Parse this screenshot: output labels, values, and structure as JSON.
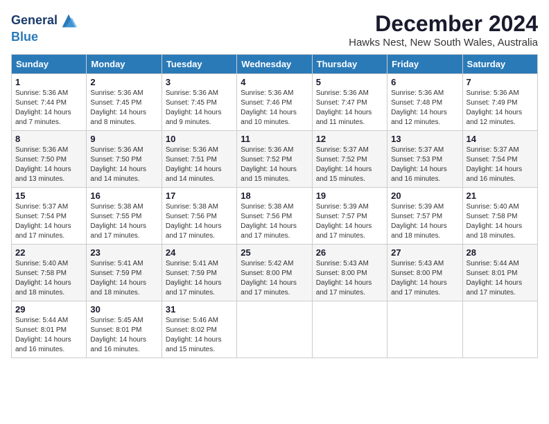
{
  "header": {
    "logo_line1": "General",
    "logo_line2": "Blue",
    "month_title": "December 2024",
    "location": "Hawks Nest, New South Wales, Australia"
  },
  "days_of_week": [
    "Sunday",
    "Monday",
    "Tuesday",
    "Wednesday",
    "Thursday",
    "Friday",
    "Saturday"
  ],
  "weeks": [
    [
      {
        "day": "1",
        "sunrise": "5:36 AM",
        "sunset": "7:44 PM",
        "daylight": "14 hours and 7 minutes."
      },
      {
        "day": "2",
        "sunrise": "5:36 AM",
        "sunset": "7:45 PM",
        "daylight": "14 hours and 8 minutes."
      },
      {
        "day": "3",
        "sunrise": "5:36 AM",
        "sunset": "7:45 PM",
        "daylight": "14 hours and 9 minutes."
      },
      {
        "day": "4",
        "sunrise": "5:36 AM",
        "sunset": "7:46 PM",
        "daylight": "14 hours and 10 minutes."
      },
      {
        "day": "5",
        "sunrise": "5:36 AM",
        "sunset": "7:47 PM",
        "daylight": "14 hours and 11 minutes."
      },
      {
        "day": "6",
        "sunrise": "5:36 AM",
        "sunset": "7:48 PM",
        "daylight": "14 hours and 12 minutes."
      },
      {
        "day": "7",
        "sunrise": "5:36 AM",
        "sunset": "7:49 PM",
        "daylight": "14 hours and 12 minutes."
      }
    ],
    [
      {
        "day": "8",
        "sunrise": "5:36 AM",
        "sunset": "7:50 PM",
        "daylight": "14 hours and 13 minutes."
      },
      {
        "day": "9",
        "sunrise": "5:36 AM",
        "sunset": "7:50 PM",
        "daylight": "14 hours and 14 minutes."
      },
      {
        "day": "10",
        "sunrise": "5:36 AM",
        "sunset": "7:51 PM",
        "daylight": "14 hours and 14 minutes."
      },
      {
        "day": "11",
        "sunrise": "5:36 AM",
        "sunset": "7:52 PM",
        "daylight": "14 hours and 15 minutes."
      },
      {
        "day": "12",
        "sunrise": "5:37 AM",
        "sunset": "7:52 PM",
        "daylight": "14 hours and 15 minutes."
      },
      {
        "day": "13",
        "sunrise": "5:37 AM",
        "sunset": "7:53 PM",
        "daylight": "14 hours and 16 minutes."
      },
      {
        "day": "14",
        "sunrise": "5:37 AM",
        "sunset": "7:54 PM",
        "daylight": "14 hours and 16 minutes."
      }
    ],
    [
      {
        "day": "15",
        "sunrise": "5:37 AM",
        "sunset": "7:54 PM",
        "daylight": "14 hours and 17 minutes."
      },
      {
        "day": "16",
        "sunrise": "5:38 AM",
        "sunset": "7:55 PM",
        "daylight": "14 hours and 17 minutes."
      },
      {
        "day": "17",
        "sunrise": "5:38 AM",
        "sunset": "7:56 PM",
        "daylight": "14 hours and 17 minutes."
      },
      {
        "day": "18",
        "sunrise": "5:38 AM",
        "sunset": "7:56 PM",
        "daylight": "14 hours and 17 minutes."
      },
      {
        "day": "19",
        "sunrise": "5:39 AM",
        "sunset": "7:57 PM",
        "daylight": "14 hours and 17 minutes."
      },
      {
        "day": "20",
        "sunrise": "5:39 AM",
        "sunset": "7:57 PM",
        "daylight": "14 hours and 18 minutes."
      },
      {
        "day": "21",
        "sunrise": "5:40 AM",
        "sunset": "7:58 PM",
        "daylight": "14 hours and 18 minutes."
      }
    ],
    [
      {
        "day": "22",
        "sunrise": "5:40 AM",
        "sunset": "7:58 PM",
        "daylight": "14 hours and 18 minutes."
      },
      {
        "day": "23",
        "sunrise": "5:41 AM",
        "sunset": "7:59 PM",
        "daylight": "14 hours and 18 minutes."
      },
      {
        "day": "24",
        "sunrise": "5:41 AM",
        "sunset": "7:59 PM",
        "daylight": "14 hours and 17 minutes."
      },
      {
        "day": "25",
        "sunrise": "5:42 AM",
        "sunset": "8:00 PM",
        "daylight": "14 hours and 17 minutes."
      },
      {
        "day": "26",
        "sunrise": "5:43 AM",
        "sunset": "8:00 PM",
        "daylight": "14 hours and 17 minutes."
      },
      {
        "day": "27",
        "sunrise": "5:43 AM",
        "sunset": "8:00 PM",
        "daylight": "14 hours and 17 minutes."
      },
      {
        "day": "28",
        "sunrise": "5:44 AM",
        "sunset": "8:01 PM",
        "daylight": "14 hours and 17 minutes."
      }
    ],
    [
      {
        "day": "29",
        "sunrise": "5:44 AM",
        "sunset": "8:01 PM",
        "daylight": "14 hours and 16 minutes."
      },
      {
        "day": "30",
        "sunrise": "5:45 AM",
        "sunset": "8:01 PM",
        "daylight": "14 hours and 16 minutes."
      },
      {
        "day": "31",
        "sunrise": "5:46 AM",
        "sunset": "8:02 PM",
        "daylight": "14 hours and 15 minutes."
      },
      null,
      null,
      null,
      null
    ]
  ]
}
